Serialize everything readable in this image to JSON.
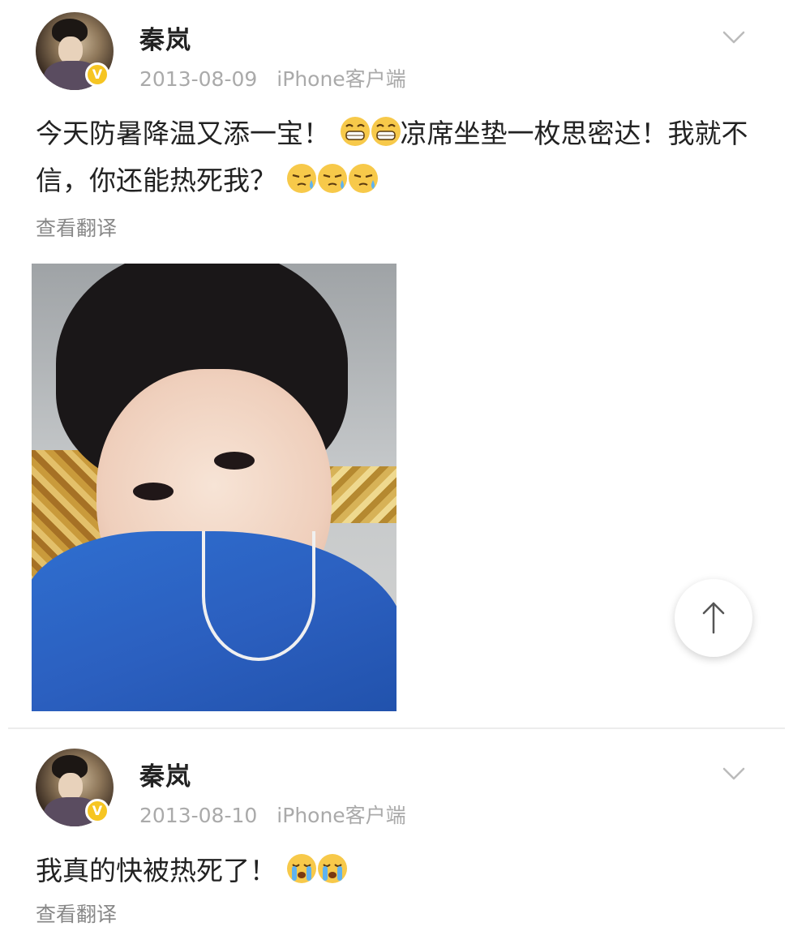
{
  "posts": [
    {
      "author": "秦岚",
      "verified_badge": "V",
      "date": "2013-08-09",
      "source": "iPhone客户端",
      "text_a": "今天防暑降温又添一宝！",
      "emoji_a": [
        "grin-emoji",
        "grin-emoji"
      ],
      "text_b": "凉席坐垫一枚思密达！我就不信，你还能热死我？",
      "emoji_b": [
        "sweat-emoji",
        "sweat-emoji",
        "sweat-emoji"
      ],
      "translate_label": "查看翻译"
    },
    {
      "author": "秦岚",
      "verified_badge": "V",
      "date": "2013-08-10",
      "source": "iPhone客户端",
      "text_a": "我真的快被热死了！",
      "emoji_a": [
        "crying-emoji",
        "crying-emoji"
      ],
      "translate_label": "查看翻译"
    }
  ],
  "colors": {
    "badge": "#f6c522",
    "meta_text": "#aaaaaa",
    "body_text": "#222222",
    "translate_text": "#888888"
  },
  "icons": {
    "more": "chevron-down-icon",
    "scroll_top": "arrow-up-icon"
  }
}
